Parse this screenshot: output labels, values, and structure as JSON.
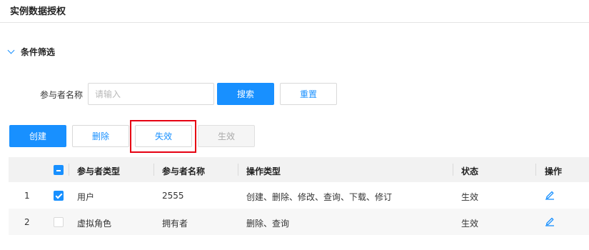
{
  "page": {
    "title": "实例数据授权"
  },
  "filter": {
    "title": "条件筛选",
    "field_label": "参与者名称",
    "placeholder": "请输入",
    "value": "",
    "search_label": "搜索",
    "reset_label": "重置"
  },
  "toolbar": {
    "create_label": "创建",
    "delete_label": "删除",
    "deactivate_label": "失效",
    "activate_label": "生效"
  },
  "table": {
    "columns": [
      "参与者类型",
      "参与者名称",
      "操作类型",
      "状态",
      "操作"
    ],
    "rows": [
      {
        "index": "1",
        "checked": true,
        "type": "用户",
        "name": "2555",
        "ops": "创建、删除、修改、查询、下载、修订",
        "status": "生效"
      },
      {
        "index": "2",
        "checked": false,
        "type": "虚拟角色",
        "name": "拥有者",
        "ops": "删除、查询",
        "status": "生效"
      }
    ]
  },
  "colors": {
    "primary": "#1890ff",
    "highlight": "#e60012"
  },
  "icons": {
    "collapse": "chevron-down-icon",
    "edit": "edit-icon"
  }
}
